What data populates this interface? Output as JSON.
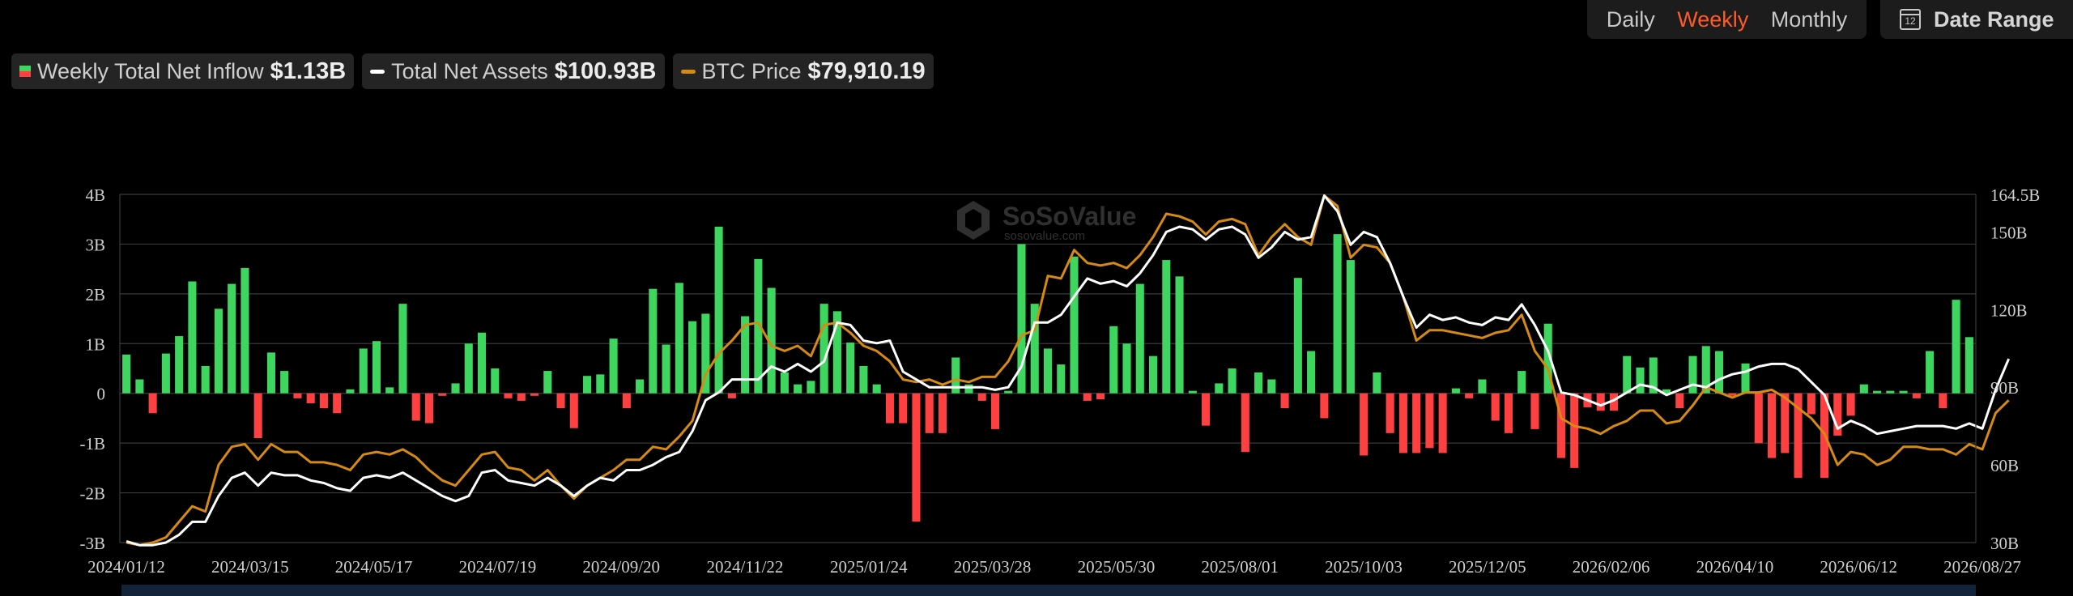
{
  "controls": {
    "daily": "Daily",
    "weekly": "Weekly",
    "monthly": "Monthly",
    "active": "Weekly",
    "date_range": "Date Range",
    "calendar_day": "12"
  },
  "legend": {
    "inflow_name": "Weekly Total Net Inflow",
    "inflow_value": "$1.13B",
    "assets_name": "Total Net Assets",
    "assets_value": "$100.93B",
    "btc_name": "BTC Price",
    "btc_value": "$79,910.19"
  },
  "watermark": {
    "brand": "SoSoValue",
    "site": "sosovalue.com"
  },
  "colors": {
    "positive": "#3ed65e",
    "negative": "#ff4040",
    "assets": "#ffffff",
    "btc": "#d68a12",
    "grid": "#3a3a3a",
    "active_tab": "#ff5a2a"
  },
  "chart_data": {
    "type": "bar",
    "x_start": "2024-01-12",
    "x_interval": "weekly",
    "x_ticks": [
      "2024/01/12",
      "2024/03/15",
      "2024/05/17",
      "2024/07/19",
      "2024/09/20",
      "2024/11/22",
      "2025/01/24",
      "2025/03/28",
      "2025/05/30",
      "2025/08/01",
      "2025/10/03",
      "2025/12/05",
      "2026/02/06",
      "2026/04/10",
      "2026/06/12",
      "2026/08/27"
    ],
    "y_left": {
      "ticks": [
        "4B",
        "3B",
        "2B",
        "1B",
        "0",
        "-1B",
        "-2B",
        "-3B"
      ],
      "min": -3,
      "max": 4,
      "unit": "B"
    },
    "y_right": {
      "ticks": [
        "164.5B",
        "150B",
        "120B",
        "90B",
        "60B",
        "30B"
      ],
      "min": 30,
      "max": 164.5,
      "unit": "B"
    },
    "series": [
      {
        "name": "Weekly Total Net Inflow",
        "type": "bar",
        "axis": "left",
        "values": [
          0.78,
          0.28,
          -0.4,
          0.8,
          1.15,
          2.25,
          0.55,
          1.7,
          2.2,
          2.52,
          -0.9,
          0.82,
          0.45,
          -0.1,
          -0.2,
          -0.3,
          -0.4,
          0.08,
          0.9,
          1.05,
          0.12,
          1.8,
          -0.55,
          -0.6,
          -0.05,
          0.2,
          1.0,
          1.22,
          0.5,
          -0.1,
          -0.15,
          -0.05,
          0.45,
          -0.3,
          -0.7,
          0.35,
          0.38,
          1.1,
          -0.3,
          0.28,
          2.1,
          0.98,
          2.22,
          1.45,
          1.6,
          3.35,
          -0.1,
          1.55,
          2.7,
          2.12,
          0.42,
          0.18,
          0.25,
          1.8,
          1.65,
          1.02,
          0.55,
          0.18,
          -0.6,
          -0.6,
          -2.58,
          -0.8,
          -0.8,
          0.72,
          0.18,
          -0.15,
          -0.72,
          0.05,
          3.0,
          1.8,
          0.9,
          0.58,
          2.75,
          -0.15,
          -0.12,
          1.35,
          1.0,
          2.2,
          0.75,
          2.68,
          2.35,
          0.05,
          -0.65,
          0.2,
          0.5,
          -1.18,
          0.42,
          0.28,
          -0.3,
          2.32,
          0.85,
          -0.5,
          3.2,
          2.68,
          -1.25,
          0.42,
          -0.8,
          -1.2,
          -1.2,
          -1.1,
          -1.2,
          0.1,
          -0.1,
          0.28,
          -0.55,
          -0.8,
          0.45,
          -0.72,
          1.4,
          -1.3,
          -1.5,
          -0.28,
          -0.35,
          -0.35,
          0.75,
          0.52,
          0.72,
          0.08,
          -0.3,
          0.75,
          0.95,
          0.85,
          -0.05,
          0.6,
          -1.0,
          -1.3,
          -1.2,
          -1.7,
          -0.42,
          -1.7,
          -0.85,
          -0.45,
          0.18,
          0.05,
          0.05,
          0.05,
          -0.1,
          0.85,
          -0.3,
          1.88,
          1.13
        ]
      },
      {
        "name": "Total Net Assets",
        "type": "line",
        "axis": "right",
        "values": [
          30.5,
          29,
          29,
          30,
          33,
          38,
          38,
          48,
          55,
          57,
          52,
          57,
          56,
          56,
          54,
          53,
          51,
          50,
          55,
          56,
          55,
          57,
          54,
          51,
          48,
          46,
          48,
          57,
          58,
          54,
          53,
          52,
          55,
          52,
          48,
          52,
          55,
          54,
          58,
          58,
          60,
          63,
          65,
          73,
          85,
          88,
          93,
          93,
          93,
          98,
          96,
          99,
          96,
          100,
          115,
          114,
          108,
          107,
          108,
          96,
          93,
          90,
          90,
          90,
          90,
          90,
          89,
          90,
          98,
          115,
          115,
          118,
          125,
          132,
          130,
          131,
          129,
          134,
          141,
          150,
          152,
          151,
          147,
          151,
          152,
          149,
          140,
          144,
          150,
          147,
          148,
          164,
          158,
          145,
          150,
          148,
          138,
          125,
          113,
          118,
          116,
          117,
          115,
          114,
          117,
          116,
          122,
          114,
          104,
          88,
          87,
          85,
          83,
          85,
          88,
          91,
          90,
          87,
          89,
          91,
          90,
          93,
          95,
          96,
          98,
          99,
          99,
          97,
          92,
          87,
          74,
          77,
          75,
          72,
          73,
          74,
          75,
          75,
          75,
          74,
          76,
          74,
          89,
          100.93
        ]
      },
      {
        "name": "BTC Price",
        "type": "line",
        "axis": "right",
        "values": [
          30,
          29,
          30,
          32,
          38,
          44,
          42,
          60,
          67,
          68,
          62,
          68,
          65,
          65,
          61,
          61,
          60,
          58,
          64,
          65,
          64,
          66,
          63,
          58,
          54,
          52,
          58,
          64,
          65,
          59,
          58,
          54,
          58,
          52,
          47,
          52,
          55,
          58,
          62,
          62,
          67,
          66,
          71,
          77,
          95,
          103,
          108,
          114,
          115,
          106,
          104,
          106,
          102,
          114,
          115,
          111,
          106,
          104,
          100,
          93,
          92,
          93,
          91,
          93,
          92,
          94,
          94,
          100,
          110,
          112,
          133,
          132,
          143,
          138,
          137,
          138,
          136,
          141,
          148,
          157,
          156,
          154,
          149,
          154,
          155,
          153,
          141,
          148,
          153,
          148,
          145,
          164,
          160,
          140,
          145,
          144,
          138,
          125,
          108,
          112,
          112,
          111,
          110,
          109,
          111,
          112,
          118,
          104,
          97,
          78,
          75,
          74,
          72,
          75,
          77,
          81,
          81,
          76,
          77,
          83,
          90,
          88,
          86,
          88,
          88,
          89,
          86,
          82,
          78,
          72,
          60,
          65,
          64,
          60,
          62,
          67,
          67,
          66,
          66,
          64,
          68,
          66,
          80,
          85
        ]
      }
    ]
  }
}
